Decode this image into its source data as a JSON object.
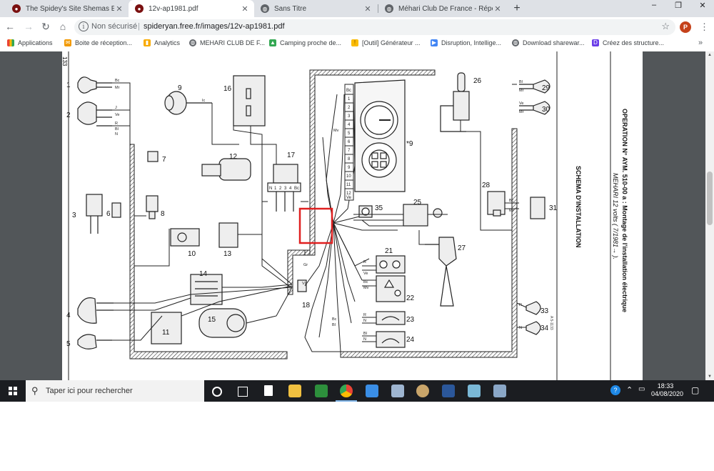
{
  "tabs": [
    {
      "title": "The Spidey's Site Shemas Electric",
      "active": false
    },
    {
      "title": "12v-ap1981.pdf",
      "active": true
    },
    {
      "title": "Sans Titre",
      "active": false
    },
    {
      "title": "Méhari Club De France - Répond",
      "active": false
    }
  ],
  "window_controls": {
    "minimize": "–",
    "maximize": "❐",
    "close": "✕"
  },
  "toolbar": {
    "security_label": "Non sécurisé",
    "url": "spideryan.free.fr/images/12v-ap1981.pdf",
    "profile_initial": "P"
  },
  "bookmarks": [
    {
      "label": "Applications",
      "color": "#4285f4"
    },
    {
      "label": "Boite de réception...",
      "color": "#f29900"
    },
    {
      "label": "Analytics",
      "color": "#f9ab00"
    },
    {
      "label": "MEHARI CLUB DE F...",
      "color": "#5f6368"
    },
    {
      "label": "Camping proche de...",
      "color": "#34a853"
    },
    {
      "label": "[Outil] Générateur ...",
      "color": "#fbbc04"
    },
    {
      "label": "Disruption, Intellige...",
      "color": "#4285f4"
    },
    {
      "label": "Download sharewar...",
      "color": "#5f6368"
    },
    {
      "label": "Créez des structure...",
      "color": "#6a3de8"
    }
  ],
  "bookmarks_more": "»",
  "pdf": {
    "title_right": "OPERATION N° AYM. 510-00 a : Montage de l'installation électrique",
    "subtitle_right": "MEHARI 12 volts ( 7/1981→ ).",
    "schema_label": "SCHEMA D'INSTALLATION",
    "page_tag": "133",
    "ref_code": "A 5-1133",
    "component_numbers": [
      "1",
      "2",
      "3",
      "4",
      "5",
      "6",
      "7",
      "8",
      "9",
      "10",
      "11",
      "12",
      "13",
      "14",
      "15",
      "16",
      "17",
      "18",
      "21",
      "22",
      "23",
      "24",
      "25",
      "26",
      "27",
      "28",
      "29",
      "30",
      "31",
      "33",
      "34",
      "35",
      "*9"
    ],
    "wire_labels": [
      "Bc",
      "Mr",
      "J",
      "Ve",
      "R",
      "Bl",
      "N",
      "Ic",
      "Mv",
      "Gr",
      "Vi"
    ],
    "connector_pins": [
      "Bc",
      "1",
      "2",
      "3",
      "4",
      "5",
      "6",
      "7",
      "8",
      "9",
      "10",
      "11",
      "12",
      "Ve"
    ],
    "relay_pins": [
      "N",
      "1",
      "2",
      "3",
      "4",
      "Bc"
    ]
  },
  "taskbar": {
    "search_placeholder": "Taper ici pour rechercher",
    "time": "18:33",
    "date": "04/08/2020"
  }
}
